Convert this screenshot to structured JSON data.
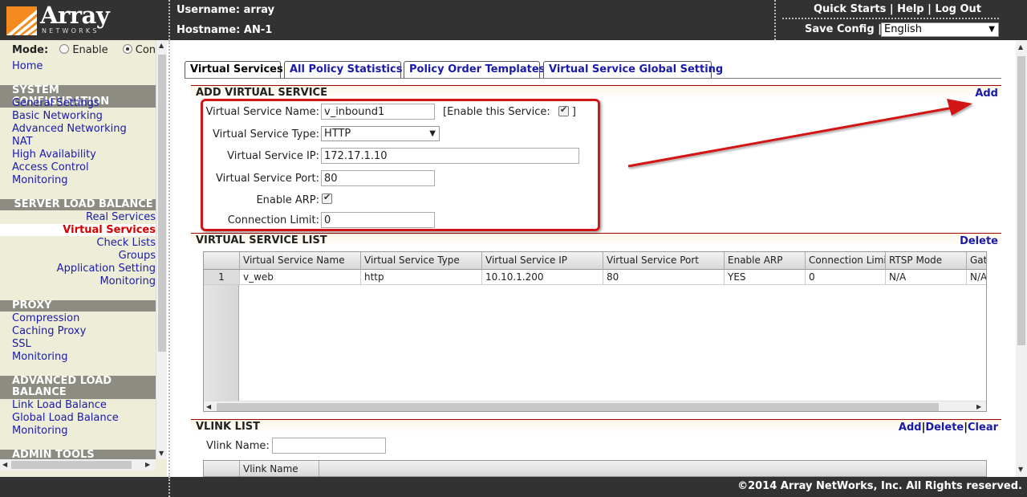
{
  "header": {
    "logo_word": "Array",
    "logo_sub": "NETWORKS",
    "username_label": "Username: array",
    "hostname_label": "Hostname: AN-1",
    "quick_starts": "Quick Starts",
    "help": "Help",
    "logout": "Log Out",
    "link_sep": " | ",
    "save_config": "Save Config |",
    "language": "English"
  },
  "sidebar": {
    "mode_label": "Mode:",
    "mode_enable": "Enable",
    "mode_config": "Config",
    "home": "Home",
    "system_head": "SYSTEM CONFIGURATION",
    "system_items": [
      "General Settings",
      "Basic Networking",
      "Advanced Networking",
      "NAT",
      "High Availability",
      "Access Control",
      "Monitoring"
    ],
    "slb_head": "SERVER LOAD BALANCE",
    "slb_items": [
      "Real Services",
      "Virtual Services",
      "Check Lists",
      "Groups",
      "Application Setting",
      "Monitoring"
    ],
    "proxy_head": "PROXY",
    "proxy_items": [
      "Compression",
      "Caching Proxy",
      "SSL",
      "Monitoring"
    ],
    "alb_head_1": "ADVANCED LOAD",
    "alb_head_2": "BALANCE",
    "alb_items": [
      "Link Load Balance",
      "Global Load Balance",
      "Monitoring"
    ],
    "admin_head": "ADMIN TOOLS"
  },
  "tabs": [
    "Virtual Services",
    "All Policy Statistics",
    "Policy Order Templates",
    "Virtual Service Global Setting"
  ],
  "add_vs": {
    "title": "ADD VIRTUAL SERVICE",
    "action": "Add",
    "name_label": "Virtual Service Name:",
    "name_value": "v_inbound1",
    "enable_prefix": "[Enable this Service:",
    "enable_suffix": "]",
    "type_label": "Virtual Service Type:",
    "type_value": "HTTP",
    "ip_label": "Virtual Service IP:",
    "ip_value": "172.17.1.10",
    "port_label": "Virtual Service Port:",
    "port_value": "80",
    "arp_label": "Enable ARP:",
    "conn_label": "Connection Limit:",
    "conn_value": "0"
  },
  "vs_list": {
    "title": "VIRTUAL SERVICE LIST",
    "action": "Delete",
    "columns": [
      "Virtual Service Name",
      "Virtual Service Type",
      "Virtual Service IP",
      "Virtual Service Port",
      "Enable ARP",
      "Connection Limit",
      "RTSP Mode",
      "Gat"
    ],
    "rows": [
      {
        "num": "1",
        "cells": [
          "v_web",
          "http",
          "10.10.1.200",
          "80",
          "YES",
          "0",
          "N/A",
          "N/A"
        ]
      }
    ]
  },
  "vlink": {
    "title": "VLINK LIST",
    "add": "Add",
    "delete": "Delete",
    "clear": "Clear",
    "sep": "|",
    "name_label": "Vlink Name:",
    "name_value": "",
    "column": "Vlink Name"
  },
  "footer": {
    "copyright": "©2014 Array NetWorks, Inc. All Rights reserved."
  },
  "colors": {
    "header_bg": "#323232",
    "sidebar_bg": "#eeeed8",
    "link": "#1a1aaa",
    "active": "#d40000",
    "annotation_red": "#d21414"
  }
}
